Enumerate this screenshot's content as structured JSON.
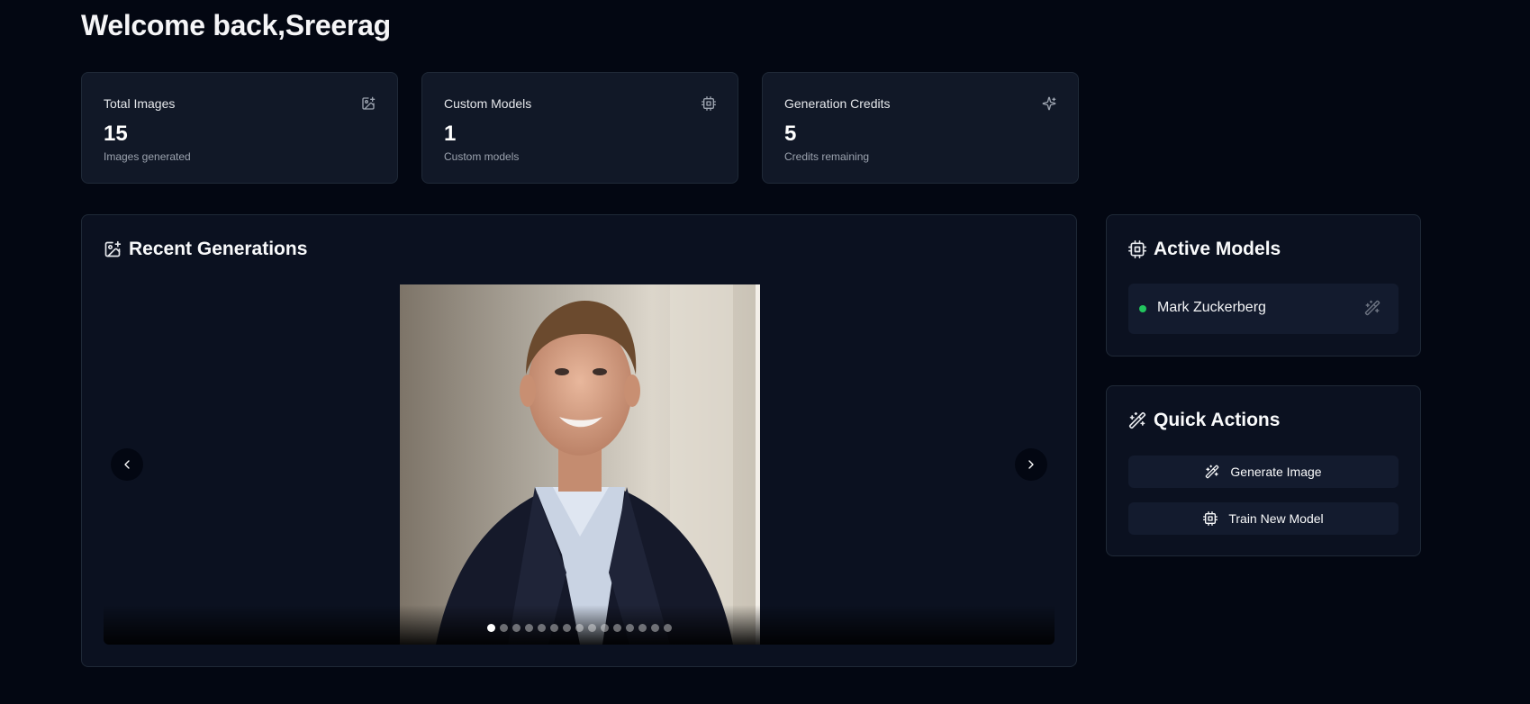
{
  "header": {
    "welcome": "Welcome back,Sreerag"
  },
  "stats": [
    {
      "label": "Total Images",
      "value": "15",
      "sub": "Images generated",
      "icon": "image-plus-icon"
    },
    {
      "label": "Custom Models",
      "value": "1",
      "sub": "Custom models",
      "icon": "cpu-icon"
    },
    {
      "label": "Generation Credits",
      "value": "5",
      "sub": "Credits remaining",
      "icon": "sparkles-icon"
    }
  ],
  "recent": {
    "title": "Recent Generations",
    "icon": "image-plus-icon",
    "slide_count": 15,
    "active_slide": 1,
    "prev_icon": "chevron-left-icon",
    "next_icon": "chevron-right-icon"
  },
  "active_models": {
    "title": "Active Models",
    "icon": "cpu-icon",
    "items": [
      {
        "name": "Mark Zuckerberg",
        "status": "active",
        "status_color": "#22c55e",
        "action_icon": "wand-sparkles-icon"
      }
    ]
  },
  "quick_actions": {
    "title": "Quick Actions",
    "icon": "wand-sparkles-icon",
    "buttons": [
      {
        "label": "Generate Image",
        "icon": "wand-sparkles-icon"
      },
      {
        "label": "Train New Model",
        "icon": "cpu-icon"
      }
    ]
  },
  "colors": {
    "background": "#030712",
    "card": "#111827",
    "border": "#1f2937",
    "accent_green": "#22c55e"
  }
}
